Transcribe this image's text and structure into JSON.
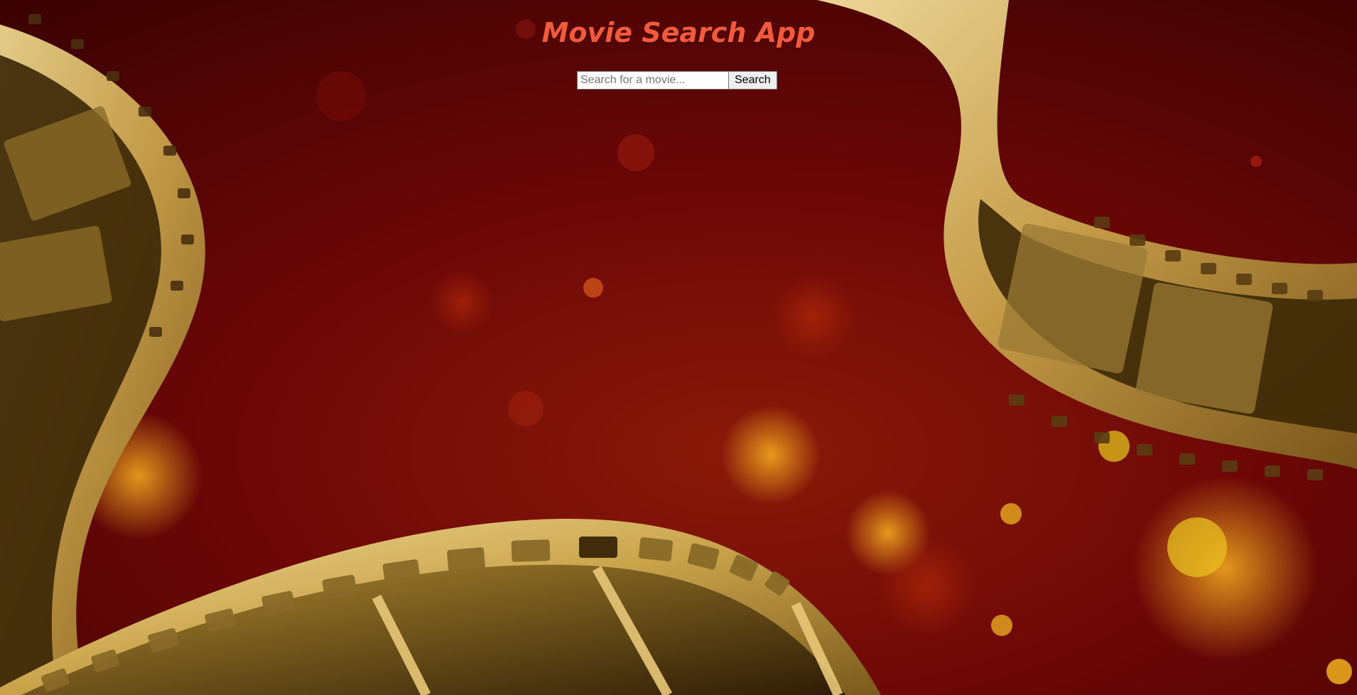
{
  "header": {
    "title": "Movie Search App"
  },
  "search": {
    "placeholder": "Search for a movie...",
    "value": "",
    "button_label": "Search"
  },
  "theme": {
    "title_color": "#f25a3c",
    "background_color": "#6a0606",
    "film_color": "#d8b860"
  },
  "background": {
    "description_icon": "film-reel-bokeh-background"
  }
}
